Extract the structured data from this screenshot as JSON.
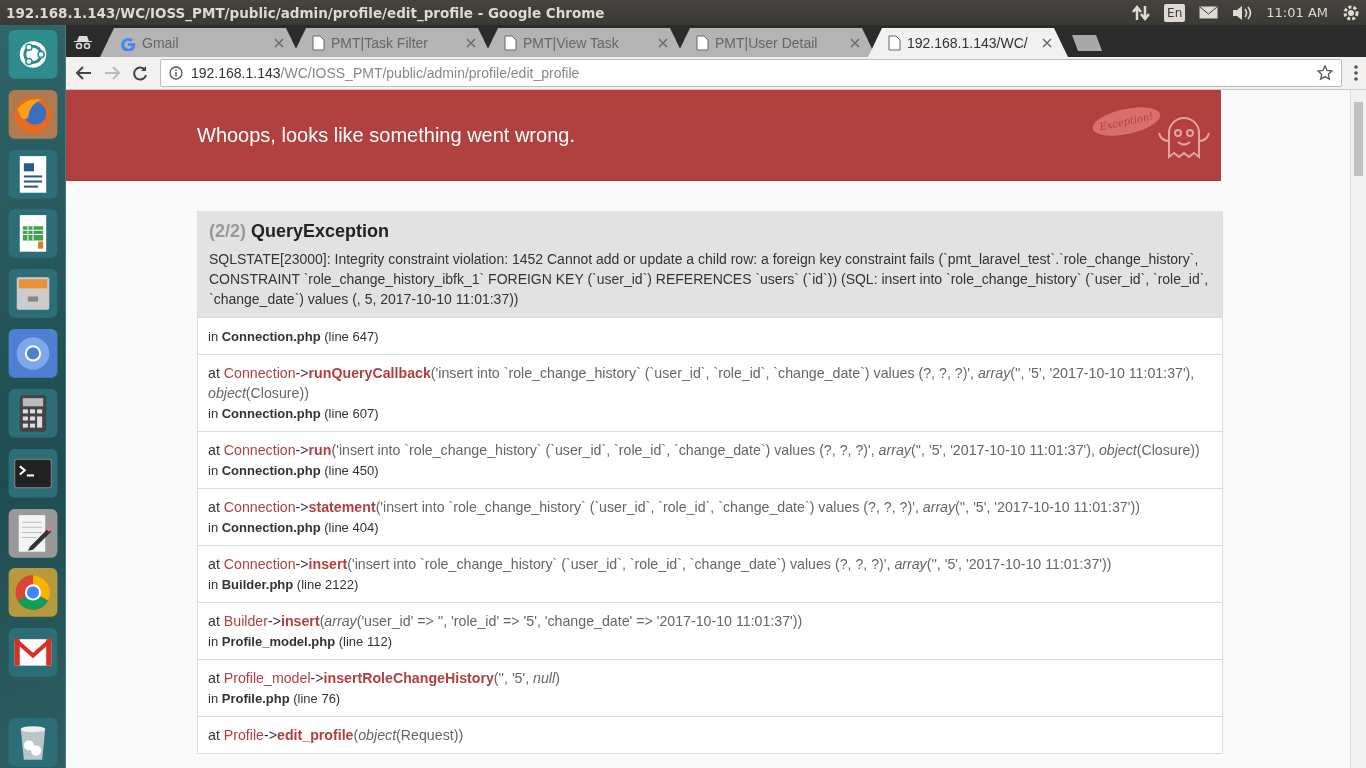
{
  "top_panel": {
    "title": "192.168.1.143/WC/IOSS_PMT/public/admin/profile/edit_profile - Google Chrome",
    "keyboard_layout": "En",
    "clock": "11:01 AM"
  },
  "browser": {
    "tabs": [
      {
        "title": "Gmail",
        "kind": "google",
        "selected": false
      },
      {
        "title": "PMT|Task Filter",
        "kind": "page",
        "selected": false
      },
      {
        "title": "PMT|View Task",
        "kind": "page",
        "selected": false
      },
      {
        "title": "PMT|User Detail",
        "kind": "page",
        "selected": false
      },
      {
        "title": "192.168.1.143/WC/",
        "kind": "page",
        "selected": true
      }
    ],
    "address": {
      "host": "192.168.1.143",
      "path": "/WC/IOSS_PMT/public/admin/profile/edit_profile"
    }
  },
  "page": {
    "header": {
      "message": "Whoops, looks like something went wrong.",
      "logo_text": "Exception!"
    },
    "exception": {
      "counter": "(2/2)",
      "name": "QueryException",
      "message": "SQLSTATE[23000]: Integrity constraint violation: 1452 Cannot add or update a child row: a foreign key constraint fails (`pmt_laravel_test`.`role_change_history`, CONSTRAINT `role_change_history_ibfk_1` FOREIGN KEY (`user_id`) REFERENCES `users` (`id`)) (SQL: insert into `role_change_history` (`user_id`, `role_id`, `change_date`) values (, 5, 2017-10-10 11:01:37))"
    },
    "frames": [
      {
        "location": "in **Connection.php** (line 647)"
      },
      {
        "call": {
          "at": "at",
          "class": "Connection",
          "arrow": "->",
          "method": "runQueryCallback",
          "args": "('insert into `role_change_history` (`user_id`, `role_id`, `change_date`) values (?, ?, ?)', *array*('', '5', '2017-10-10 11:01:37'), *object*(Closure))"
        },
        "location": "in **Connection.php** (line 607)"
      },
      {
        "call": {
          "at": "at",
          "class": "Connection",
          "arrow": "->",
          "method": "run",
          "args": "('insert into `role_change_history` (`user_id`, `role_id`, `change_date`) values (?, ?, ?)', *array*('', '5', '2017-10-10 11:01:37'), *object*(Closure))"
        },
        "location": "in **Connection.php** (line 450)"
      },
      {
        "call": {
          "at": "at",
          "class": "Connection",
          "arrow": "->",
          "method": "statement",
          "args": "('insert into `role_change_history` (`user_id`, `role_id`, `change_date`) values (?, ?, ?)', *array*('', '5', '2017-10-10 11:01:37'))"
        },
        "location": "in **Connection.php** (line 404)"
      },
      {
        "call": {
          "at": "at",
          "class": "Connection",
          "arrow": "->",
          "method": "insert",
          "args": "('insert into `role_change_history` (`user_id`, `role_id`, `change_date`) values (?, ?, ?)', *array*('', '5', '2017-10-10 11:01:37'))"
        },
        "location": "in **Builder.php** (line 2122)"
      },
      {
        "call": {
          "at": "at",
          "class": "Builder",
          "arrow": "->",
          "method": "insert",
          "args": "(*array*('user_id' => '', 'role_id' => '5', 'change_date' => '2017-10-10 11:01:37'))"
        },
        "location": "in **Profile_model.php** (line 112)"
      },
      {
        "call": {
          "at": "at",
          "class": "Profile_model",
          "arrow": "->",
          "method": "insertRoleChangeHistory",
          "args": "('', '5', *null*)"
        },
        "location": "in **Profile.php** (line 76)"
      },
      {
        "call": {
          "at": "at",
          "class": "Profile",
          "arrow": "->",
          "method": "edit_profile",
          "args": "(*object*(Request))"
        }
      }
    ]
  }
}
